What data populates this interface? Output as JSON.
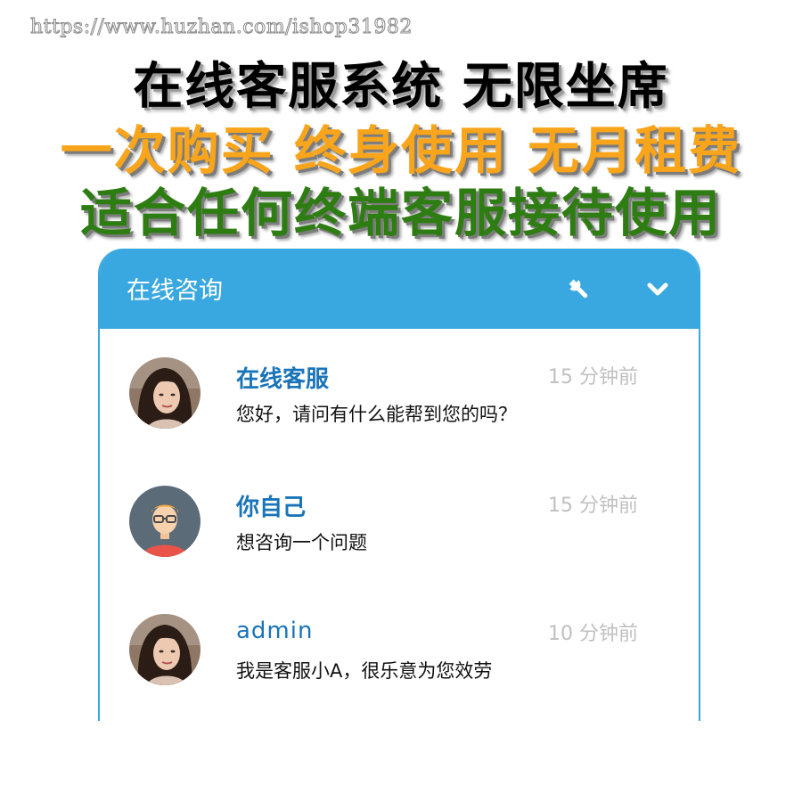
{
  "watermark": "https://www.huzhan.com/ishop31982",
  "banner": {
    "line1": "在线客服系统 无限坐席",
    "line2": "一次购买 终身使用 无月租费",
    "line3": "适合任何终端客服接待使用"
  },
  "colors": {
    "header_bg": "#3aa8e0",
    "name_text": "#1a74b8",
    "line2_text": "#f9a51b",
    "line3_text": "#2e7d12"
  },
  "chat": {
    "title": "在线咨询",
    "header_icons": [
      "wrench-icon",
      "chevron-down-icon"
    ],
    "conversations": [
      {
        "name": "在线客服",
        "time": "15 分钟前",
        "message": "您好，请问有什么能帮到您的吗？",
        "avatar": "photo-avatar"
      },
      {
        "name": "你自己",
        "time": "15 分钟前",
        "message": "想咨询一个问题",
        "avatar": "cartoon-avatar"
      },
      {
        "name": "admin",
        "time": "10 分钟前",
        "message": "我是客服小A，很乐意为您效劳",
        "avatar": "photo-avatar"
      }
    ]
  }
}
